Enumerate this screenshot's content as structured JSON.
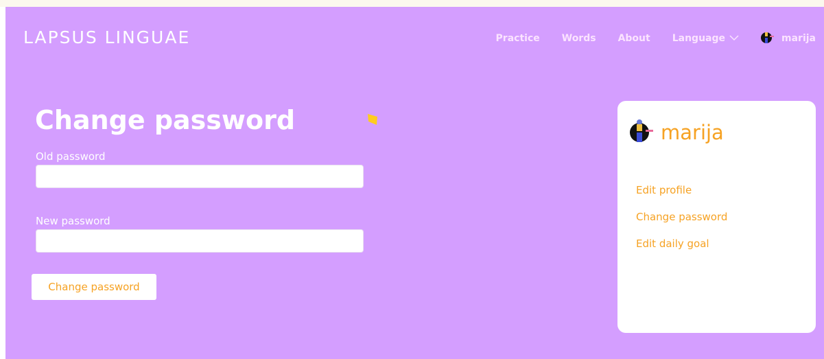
{
  "brand": "LAPSUS LINGUAE",
  "nav": {
    "items": [
      {
        "label": "Practice"
      },
      {
        "label": "Words"
      },
      {
        "label": "About"
      },
      {
        "label": "Language"
      }
    ],
    "username": "marija"
  },
  "form": {
    "title": "Change password",
    "old_label": "Old password",
    "old_value": "",
    "new_label": "New password",
    "new_value": "",
    "submit_label": "Change password"
  },
  "card": {
    "username": "marija",
    "links": [
      {
        "label": "Edit profile"
      },
      {
        "label": "Change password"
      },
      {
        "label": "Edit daily goal"
      }
    ]
  },
  "colors": {
    "background": "#d49eff",
    "accent": "#f6a223",
    "diamond": "#ffcc1f"
  },
  "icons": {
    "avatar": "avatar-icon",
    "dropdown": "chevron-down-icon",
    "decoration": "diamond-icon"
  }
}
